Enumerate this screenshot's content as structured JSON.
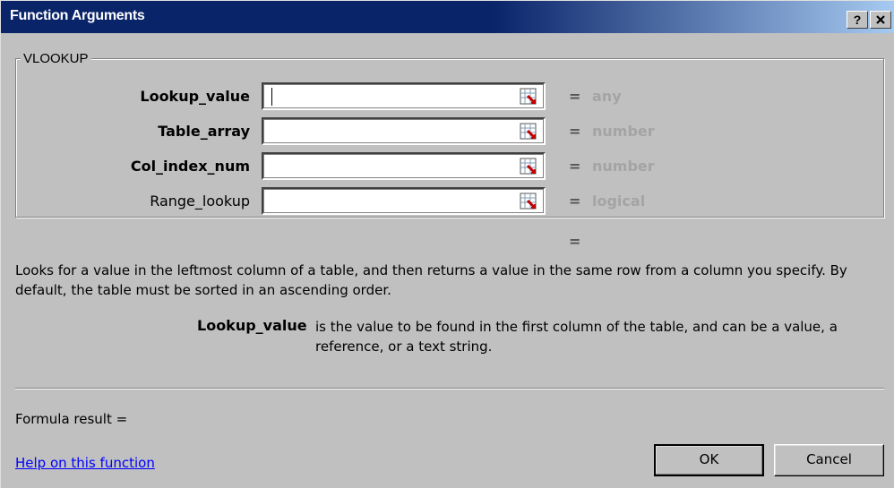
{
  "window": {
    "title": "Function Arguments",
    "help_button": "?",
    "close_button": "X"
  },
  "group": {
    "legend": "VLOOKUP"
  },
  "arguments": [
    {
      "name": "Lookup_value",
      "value": "",
      "result": "any",
      "bold": true
    },
    {
      "name": "Table_array",
      "value": "",
      "result": "number",
      "bold": true
    },
    {
      "name": "Col_index_num",
      "value": "",
      "result": "number",
      "bold": true
    },
    {
      "name": "Range_lookup",
      "value": "",
      "result": "logical",
      "bold": false
    }
  ],
  "equals_sign": "=",
  "function_result_equals": "=",
  "description": "Looks for a value in the leftmost column of a table, and then returns a value in the same row from a column you specify. By default, the table must be sorted in an ascending order.",
  "argument_help": {
    "name": "Lookup_value",
    "text": "is the value to be found in the first column of the table, and can be a value, a reference, or a text string."
  },
  "formula_result": "Formula result =",
  "help_link": "Help on this function",
  "buttons": {
    "ok": "OK",
    "cancel": "Cancel"
  },
  "colors": {
    "title_bar": "#0a246a",
    "dialog_bg": "#c0c0c0",
    "hint_text": "#a4a4a4",
    "link": "#0000ff"
  }
}
